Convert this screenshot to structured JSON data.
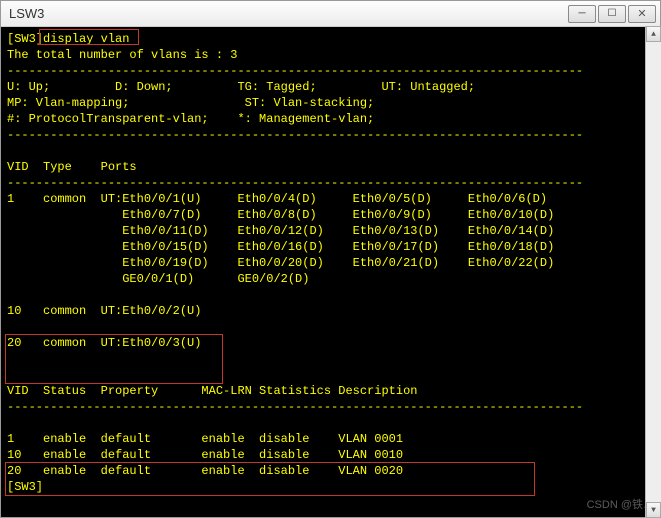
{
  "window": {
    "title": "LSW3"
  },
  "terminal": {
    "prompt": "[SW3]",
    "command": "display vlan",
    "total_line": "The total number of vlans is : 3",
    "divider": "--------------------------------------------------------------------------------",
    "legend": {
      "l1": "U: Up;         D: Down;         TG: Tagged;         UT: Untagged;",
      "l2": "MP: Vlan-mapping;                ST: Vlan-stacking;",
      "l3": "#: ProtocolTransparent-vlan;    *: Management-vlan;"
    },
    "header1": "VID  Type    Ports",
    "vlan_rows": [
      {
        "vid": "1",
        "type": "common",
        "ports_lines": [
          "UT:Eth0/0/1(U)     Eth0/0/4(D)     Eth0/0/5(D)     Eth0/0/6(D)",
          "   Eth0/0/7(D)     Eth0/0/8(D)     Eth0/0/9(D)     Eth0/0/10(D)",
          "   Eth0/0/11(D)    Eth0/0/12(D)    Eth0/0/13(D)    Eth0/0/14(D)",
          "   Eth0/0/15(D)    Eth0/0/16(D)    Eth0/0/17(D)    Eth0/0/18(D)",
          "   Eth0/0/19(D)    Eth0/0/20(D)    Eth0/0/21(D)    Eth0/0/22(D)",
          "   GE0/0/1(D)      GE0/0/2(D)"
        ]
      },
      {
        "vid": "10",
        "type": "common",
        "ports_lines": [
          "UT:Eth0/0/2(U)"
        ]
      },
      {
        "vid": "20",
        "type": "common",
        "ports_lines": [
          "UT:Eth0/0/3(U)"
        ]
      }
    ],
    "header2": "VID  Status  Property      MAC-LRN Statistics Description",
    "status_rows": [
      {
        "vid": "1",
        "status": "enable",
        "property": "default",
        "mac": "enable",
        "stats": "disable",
        "desc": "VLAN 0001"
      },
      {
        "vid": "10",
        "status": "enable",
        "property": "default",
        "mac": "enable",
        "stats": "disable",
        "desc": "VLAN 0010"
      },
      {
        "vid": "20",
        "status": "enable",
        "property": "default",
        "mac": "enable",
        "stats": "disable",
        "desc": "VLAN 0020"
      }
    ],
    "end_prompt": "[SW3]"
  },
  "watermark": "CSDN @铁…"
}
